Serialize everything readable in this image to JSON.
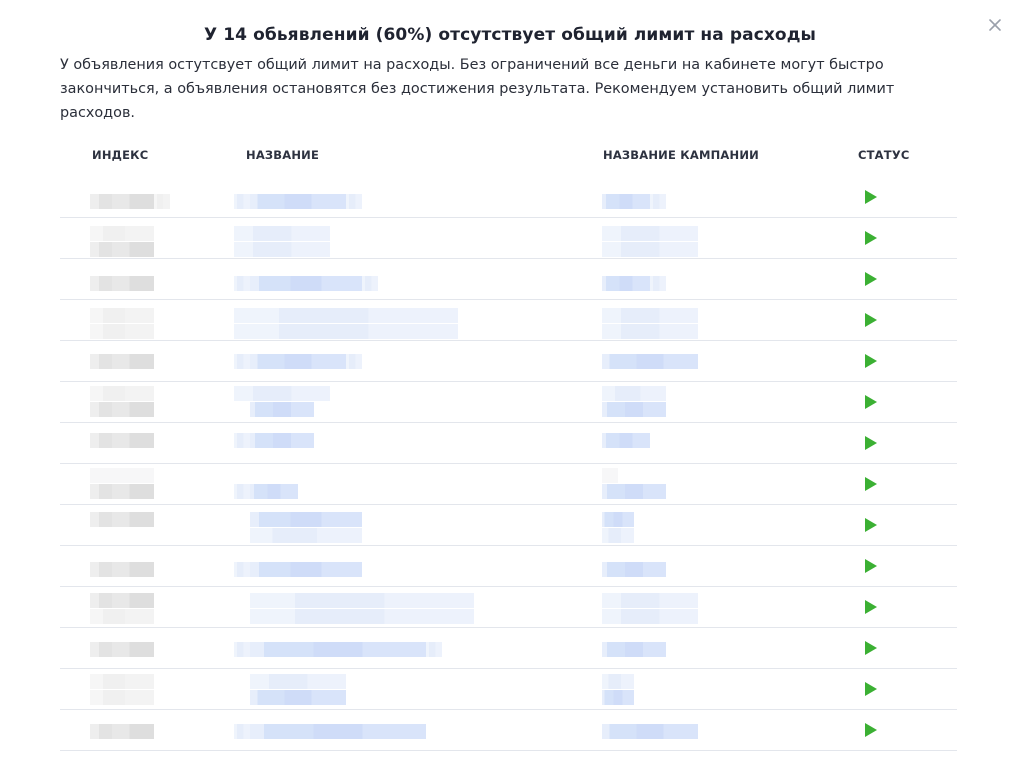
{
  "modal": {
    "title": "У 14 обьявлений (60%) отсутствует общий лимит на расходы",
    "description": "У объявления остутсвует общий лимит на расходы. Без ограничений все деньги на кабинете могут быстро закончиться, а объявления остановятся без достижения результата. Рекомендуем установить общий лимит расходов.",
    "close_icon": "close-icon"
  },
  "table": {
    "columns": {
      "index": "ИНДЕКС",
      "name": "НАЗВАНИЕ",
      "campaign": "НАЗВАНИЕ КАМПАНИИ",
      "status": "СТАТУС"
    },
    "status_icon": "play-icon",
    "status_color": "#3bb033",
    "row_count": 14
  }
}
